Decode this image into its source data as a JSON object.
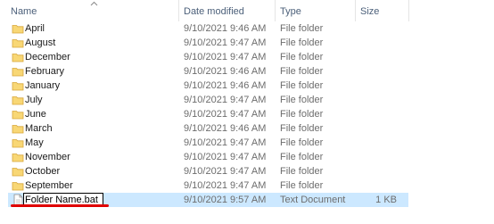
{
  "columns": {
    "name": "Name",
    "date_modified": "Date modified",
    "type": "Type",
    "size": "Size"
  },
  "rows": [
    {
      "name": "April",
      "date": "9/10/2021 9:46 AM",
      "type": "File folder",
      "size": "",
      "icon": "folder-icon"
    },
    {
      "name": "August",
      "date": "9/10/2021 9:47 AM",
      "type": "File folder",
      "size": "",
      "icon": "folder-icon"
    },
    {
      "name": "December",
      "date": "9/10/2021 9:47 AM",
      "type": "File folder",
      "size": "",
      "icon": "folder-icon"
    },
    {
      "name": "February",
      "date": "9/10/2021 9:46 AM",
      "type": "File folder",
      "size": "",
      "icon": "folder-icon"
    },
    {
      "name": "January",
      "date": "9/10/2021 9:46 AM",
      "type": "File folder",
      "size": "",
      "icon": "folder-icon"
    },
    {
      "name": "July",
      "date": "9/10/2021 9:47 AM",
      "type": "File folder",
      "size": "",
      "icon": "folder-icon"
    },
    {
      "name": "June",
      "date": "9/10/2021 9:47 AM",
      "type": "File folder",
      "size": "",
      "icon": "folder-icon"
    },
    {
      "name": "March",
      "date": "9/10/2021 9:46 AM",
      "type": "File folder",
      "size": "",
      "icon": "folder-icon"
    },
    {
      "name": "May",
      "date": "9/10/2021 9:47 AM",
      "type": "File folder",
      "size": "",
      "icon": "folder-icon"
    },
    {
      "name": "November",
      "date": "9/10/2021 9:47 AM",
      "type": "File folder",
      "size": "",
      "icon": "folder-icon"
    },
    {
      "name": "October",
      "date": "9/10/2021 9:47 AM",
      "type": "File folder",
      "size": "",
      "icon": "folder-icon"
    },
    {
      "name": "September",
      "date": "9/10/2021 9:47 AM",
      "type": "File folder",
      "size": "",
      "icon": "folder-icon"
    }
  ],
  "selected_file": {
    "rename_value": "Folder Name.bat",
    "date": "9/10/2021 9:57 AM",
    "type": "Text Document",
    "size": "1 KB",
    "icon": "text-document-icon"
  },
  "colors": {
    "header_text": "#4c607a",
    "selection": "#cce8ff",
    "folder": "#f8d775",
    "annotation_underline": "#e00000"
  }
}
